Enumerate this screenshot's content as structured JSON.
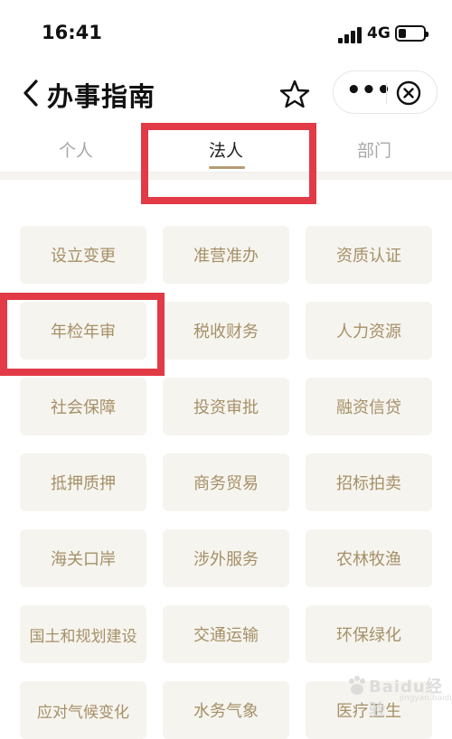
{
  "status": {
    "time": "16:41",
    "network": "4G",
    "battery_level": 0.3
  },
  "nav": {
    "title": "办事指南"
  },
  "tabs": [
    {
      "label": "个人",
      "active": false
    },
    {
      "label": "法人",
      "active": true
    },
    {
      "label": "部门",
      "active": false
    }
  ],
  "grid": {
    "items": [
      "设立变更",
      "准营准办",
      "资质认证",
      "年检年审",
      "税收财务",
      "人力资源",
      "社会保障",
      "投资审批",
      "融资信贷",
      "抵押质押",
      "商务贸易",
      "招标拍卖",
      "海关口岸",
      "涉外服务",
      "农林牧渔",
      "国土和规划建设",
      "交通运输",
      "环保绿化",
      "应对气候变化",
      "水务气象",
      "医疗卫生"
    ]
  },
  "highlights": {
    "tab": "法人",
    "item": "年检年审"
  },
  "watermark": {
    "brand": "Baidu经验",
    "url": "jingyan.baidu.com"
  },
  "colors": {
    "accent": "#b59c73",
    "item_text": "#a59067",
    "item_bg": "#f6f4ef",
    "highlight": "#e23a46"
  }
}
